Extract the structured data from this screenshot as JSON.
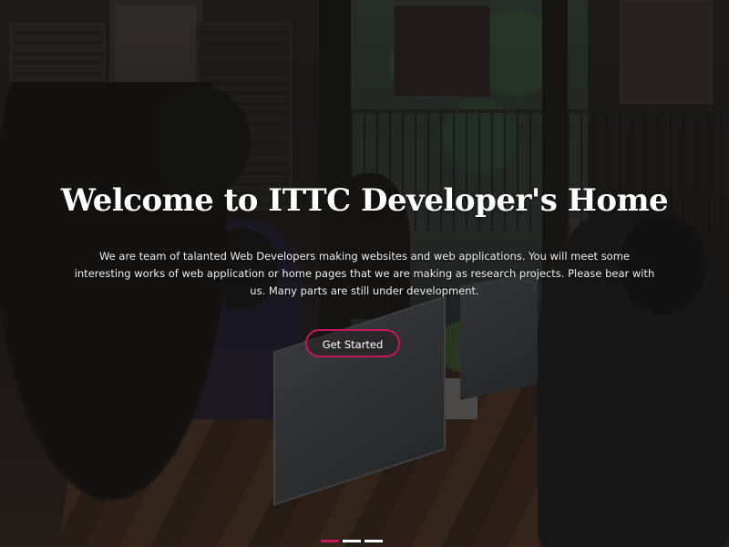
{
  "hero": {
    "title": "Welcome to ITTC Developer's Home",
    "description": "We are team of talanted Web Developers making websites and web applications. You will meet some interesting works of web application or home pages that we are making as research projects. Please bear with us. Many parts are still under development.",
    "cta_label": "Get Started"
  },
  "carousel": {
    "slide_count": 3,
    "active_index": 0
  },
  "colors": {
    "accent": "#c2185b",
    "text": "#ffffff"
  }
}
